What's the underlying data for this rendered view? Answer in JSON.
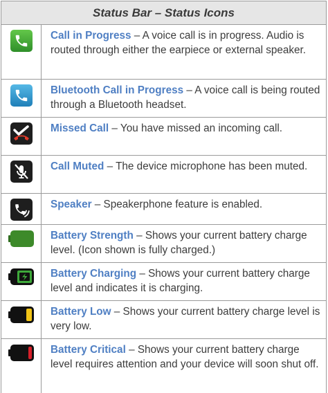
{
  "table": {
    "title": "Status Bar – Status Icons",
    "rows": [
      {
        "icon": "call-in-progress-icon",
        "term": "Call in Progress",
        "desc": " – A voice call is in progress. Audio is routed through either the earpiece or external speaker."
      },
      {
        "icon": "bluetooth-call-icon",
        "term": "Bluetooth Call in Progress",
        "desc": " – A voice call is being routed through a Bluetooth headset."
      },
      {
        "icon": "missed-call-icon",
        "term": "Missed Call",
        "desc": " – You have missed an incoming call."
      },
      {
        "icon": "call-muted-icon",
        "term": "Call Muted",
        "desc": " – The device microphone has been muted."
      },
      {
        "icon": "speaker-icon",
        "term": "Speaker",
        "desc": " – Speakerphone feature is enabled."
      },
      {
        "icon": "battery-full-icon",
        "term": "Battery Strength",
        "desc": " – Shows your current battery charge level. (Icon shown is fully charged.)"
      },
      {
        "icon": "battery-charging-icon",
        "term": "Battery Charging",
        "desc": " – Shows your current battery charge level and indicates it is charging."
      },
      {
        "icon": "battery-low-icon",
        "term": "Battery Low",
        "desc": " – Shows your current battery charge level is very low."
      },
      {
        "icon": "battery-critical-icon",
        "term": "Battery Critical",
        "desc": " – Shows your current battery charge level requires attention and your device will soon shut off."
      }
    ]
  },
  "colors": {
    "term": "#4f7fc3",
    "call_green": "#3ea93a",
    "bluetooth_blue": "#2f9fd6",
    "battery_green": "#3d8a2a",
    "battery_yellow": "#f2c417",
    "battery_red": "#d8202a"
  }
}
